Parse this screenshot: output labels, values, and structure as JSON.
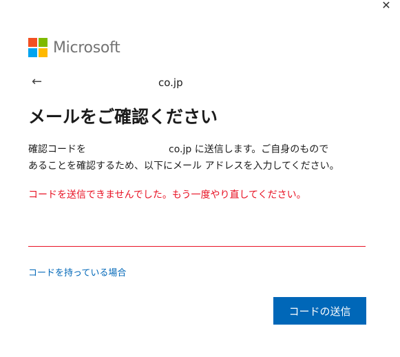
{
  "window": {
    "close_glyph": "✕"
  },
  "logo": {
    "text": "Microsoft",
    "colors": [
      "#f25022",
      "#7fba00",
      "#00a4ef",
      "#ffb900"
    ]
  },
  "back": {
    "arrow_glyph": "←"
  },
  "identity": {
    "text": "co.jp"
  },
  "title": "メールをご確認ください",
  "description": {
    "part1": "確認コードを",
    "part2": "co.jp に送信します。ご自身のもので",
    "line2": "あることを確認するため、以下にメール アドレスを入力してください。"
  },
  "error": {
    "text": "コードを送信できませんでした。もう一度やり直してください。",
    "color": "#e81123"
  },
  "input": {
    "value": "",
    "placeholder": ""
  },
  "links": {
    "have_code": "コードを持っている場合"
  },
  "buttons": {
    "send_code": "コードの送信"
  },
  "colors": {
    "accent": "#0067b8",
    "error": "#e81123"
  }
}
